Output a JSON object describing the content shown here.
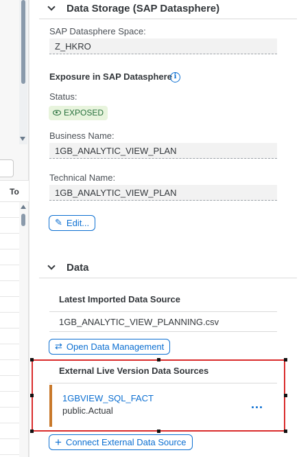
{
  "left_pane": {
    "column_header": "To"
  },
  "data_storage": {
    "section_title": "Data Storage (SAP Datasphere)",
    "space_label": "SAP Datasphere Space:",
    "space_value": "Z_HKRO",
    "exposure_title": "Exposure in SAP Datasphere",
    "info_glyph": "i",
    "status_label": "Status:",
    "status_value": "EXPOSED",
    "business_name_label": "Business Name:",
    "business_name_value": "1GB_ANALYTIC_VIEW_PLAN",
    "technical_name_label": "Technical Name:",
    "technical_name_value": "1GB_ANALYTIC_VIEW_PLAN",
    "edit_button": "Edit..."
  },
  "data": {
    "section_title": "Data",
    "latest_imported_label": "Latest Imported Data Source",
    "latest_imported_value": "1GB_ANALYTIC_VIEW_PLANNING.csv",
    "open_data_mgmt_button": "Open Data Management",
    "external_live_title": "External Live Version Data Sources",
    "external_sources": [
      {
        "name": "1GBVIEW_SQL_FACT",
        "sub": "public.Actual",
        "more": "..."
      }
    ],
    "connect_button": "Connect External Data Source",
    "plus_glyph": "+"
  },
  "colors": {
    "accent": "#0a6ed1",
    "status_green": "#256f3a",
    "status_bg": "#e8f4dd",
    "row_bar": "#c8782a",
    "highlight": "#d92a2a"
  },
  "icons": [
    "chevron-down-icon",
    "info-icon",
    "eye-icon",
    "edit-pencil-icon",
    "data-management-icon",
    "more-icon",
    "plus-icon"
  ]
}
